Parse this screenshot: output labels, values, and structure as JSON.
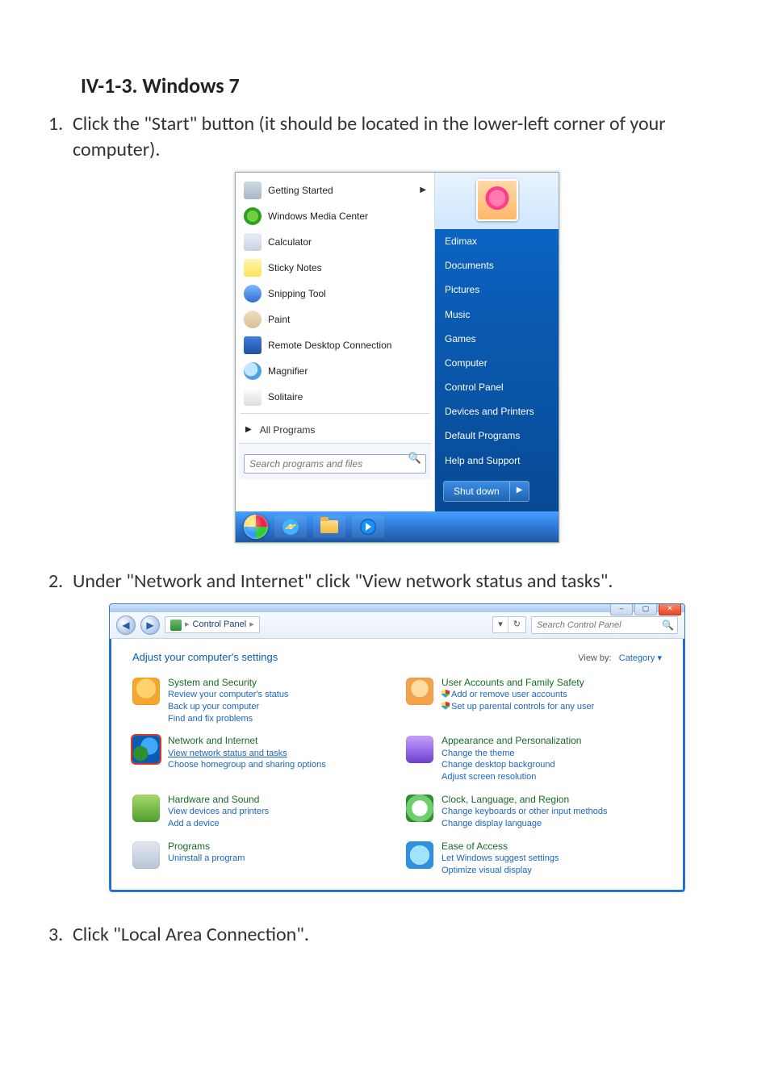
{
  "doc": {
    "heading": "IV-1-3.    Windows 7",
    "step1": "Click the \"Start\" button (it should be located in the lower-left corner of your computer).",
    "step2": "Under \"Network and Internet\" click \"View network status and tasks\".",
    "step3": "Click \"Local Area Connection\"."
  },
  "startmenu": {
    "programs": {
      "getting_started": "Getting Started",
      "wmc": "Windows Media Center",
      "calculator": "Calculator",
      "sticky_notes": "Sticky Notes",
      "snipping_tool": "Snipping Tool",
      "paint": "Paint",
      "rdc": "Remote Desktop Connection",
      "magnifier": "Magnifier",
      "solitaire": "Solitaire",
      "all_programs": "All Programs"
    },
    "search_placeholder": "Search programs and files",
    "right": {
      "user": "Edimax",
      "documents": "Documents",
      "pictures": "Pictures",
      "music": "Music",
      "games": "Games",
      "computer": "Computer",
      "control_panel": "Control Panel",
      "devices": "Devices and Printers",
      "default_programs": "Default Programs",
      "help": "Help and Support"
    },
    "shutdown": "Shut down"
  },
  "cp": {
    "breadcrumb": "Control Panel",
    "search_placeholder": "Search Control Panel",
    "title": "Adjust your computer's settings",
    "viewby_label": "View by:",
    "viewby_value": "Category",
    "cats": {
      "system": {
        "head": "System and Security",
        "l1": "Review your computer's status",
        "l2": "Back up your computer",
        "l3": "Find and fix problems"
      },
      "network": {
        "head": "Network and Internet",
        "l1": "View network status and tasks",
        "l2": "Choose homegroup and sharing options"
      },
      "hardware": {
        "head": "Hardware and Sound",
        "l1": "View devices and printers",
        "l2": "Add a device"
      },
      "programs": {
        "head": "Programs",
        "l1": "Uninstall a program"
      },
      "users": {
        "head": "User Accounts and Family Safety",
        "l1": "Add or remove user accounts",
        "l2": "Set up parental controls for any user"
      },
      "appearance": {
        "head": "Appearance and Personalization",
        "l1": "Change the theme",
        "l2": "Change desktop background",
        "l3": "Adjust screen resolution"
      },
      "clock": {
        "head": "Clock, Language, and Region",
        "l1": "Change keyboards or other input methods",
        "l2": "Change display language"
      },
      "ease": {
        "head": "Ease of Access",
        "l1": "Let Windows suggest settings",
        "l2": "Optimize visual display"
      }
    }
  }
}
